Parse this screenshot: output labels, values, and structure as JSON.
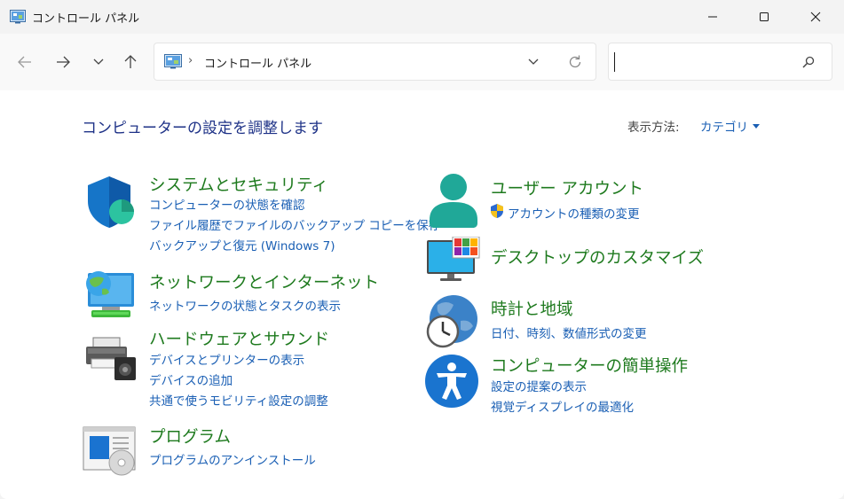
{
  "window": {
    "title": "コントロール パネル",
    "minimize_icon": "minimize-icon",
    "maximize_icon": "maximize-icon",
    "close_icon": "close-icon"
  },
  "nav": {
    "back_icon": "arrow-left-icon",
    "forward_icon": "arrow-right-icon",
    "recent_icon": "chevron-down-icon",
    "up_icon": "arrow-up-icon"
  },
  "address": {
    "separator": "›",
    "path": "コントロール パネル"
  },
  "search": {
    "value": "",
    "placeholder": ""
  },
  "header": {
    "title": "コンピューターの設定を調整します",
    "view_label": "表示方法:",
    "view_value": "カテゴリ"
  },
  "categories": {
    "security": {
      "title": "システムとセキュリティ",
      "links": [
        "コンピューターの状態を確認",
        "ファイル履歴でファイルのバックアップ コピーを保存",
        "バックアップと復元 (Windows 7)"
      ]
    },
    "network": {
      "title": "ネットワークとインターネット",
      "links": [
        "ネットワークの状態とタスクの表示"
      ]
    },
    "hardware": {
      "title": "ハードウェアとサウンド",
      "links": [
        "デバイスとプリンターの表示",
        "デバイスの追加",
        "共通で使うモビリティ設定の調整"
      ]
    },
    "programs": {
      "title": "プログラム",
      "links": [
        "プログラムのアンインストール"
      ]
    },
    "users": {
      "title": "ユーザー アカウント",
      "links": [
        "アカウントの種類の変更"
      ]
    },
    "appearance": {
      "title": "デスクトップのカスタマイズ",
      "links": []
    },
    "clock": {
      "title": "時計と地域",
      "links": [
        "日付、時刻、数値形式の変更"
      ]
    },
    "ease": {
      "title": "コンピューターの簡単操作",
      "links": [
        "設定の提案の表示",
        "視覚ディスプレイの最適化"
      ]
    }
  }
}
